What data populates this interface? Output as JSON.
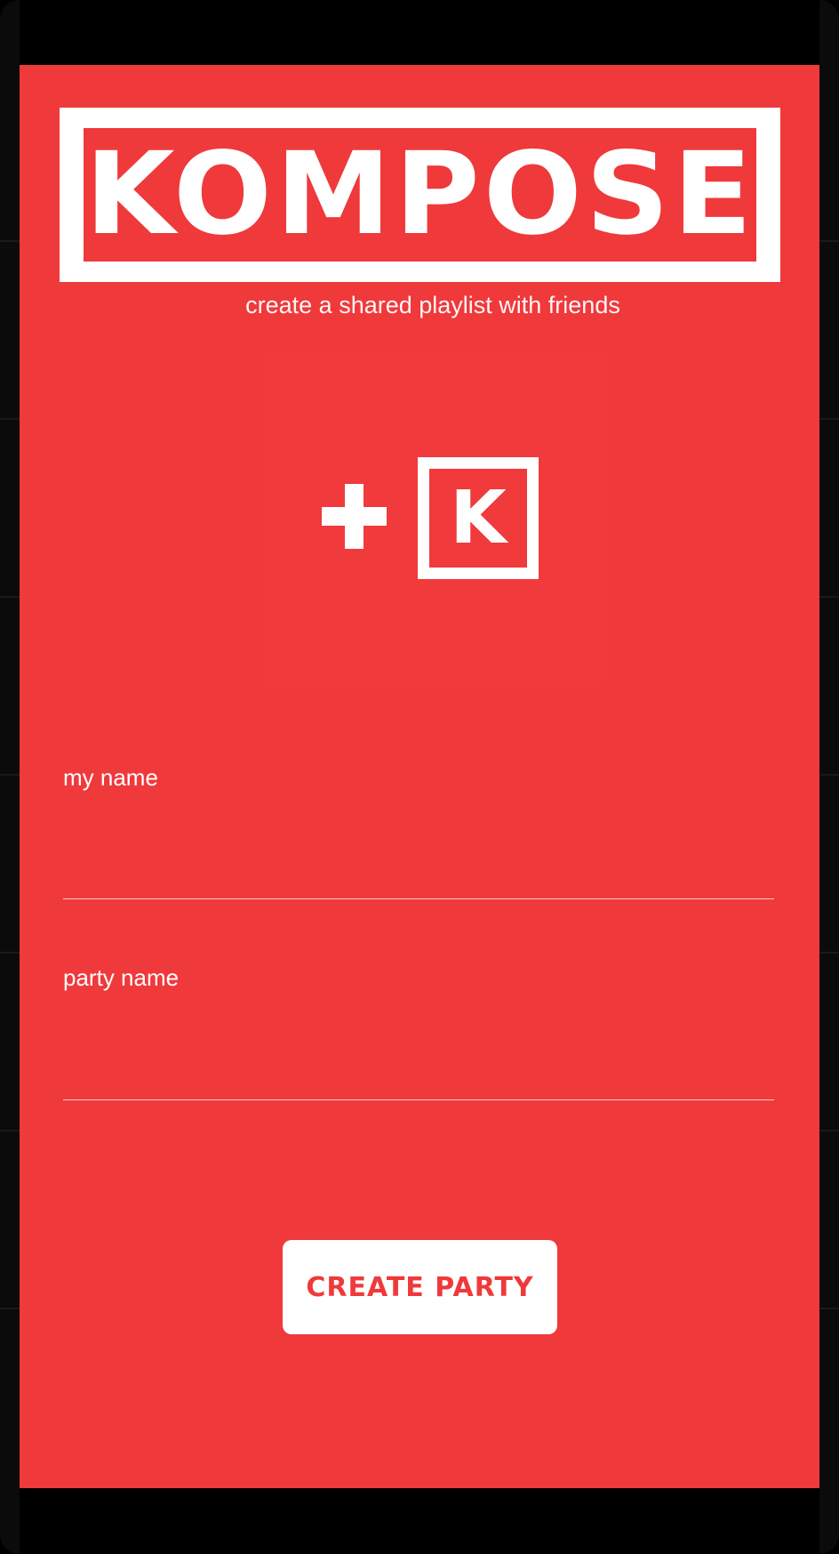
{
  "app": {
    "logo_text": "KOMPOSE",
    "tagline": "create a shared playlist with friends"
  },
  "icons": {
    "add": "plus-icon",
    "brand": "k-logo-icon",
    "brand_letter": "K"
  },
  "form": {
    "my_name": {
      "label": "my name",
      "value": ""
    },
    "party_name": {
      "label": "party name",
      "value": ""
    },
    "submit_label": "CREATE PARTY"
  },
  "colors": {
    "accent": "#ef393b",
    "text": "#ffffff"
  }
}
